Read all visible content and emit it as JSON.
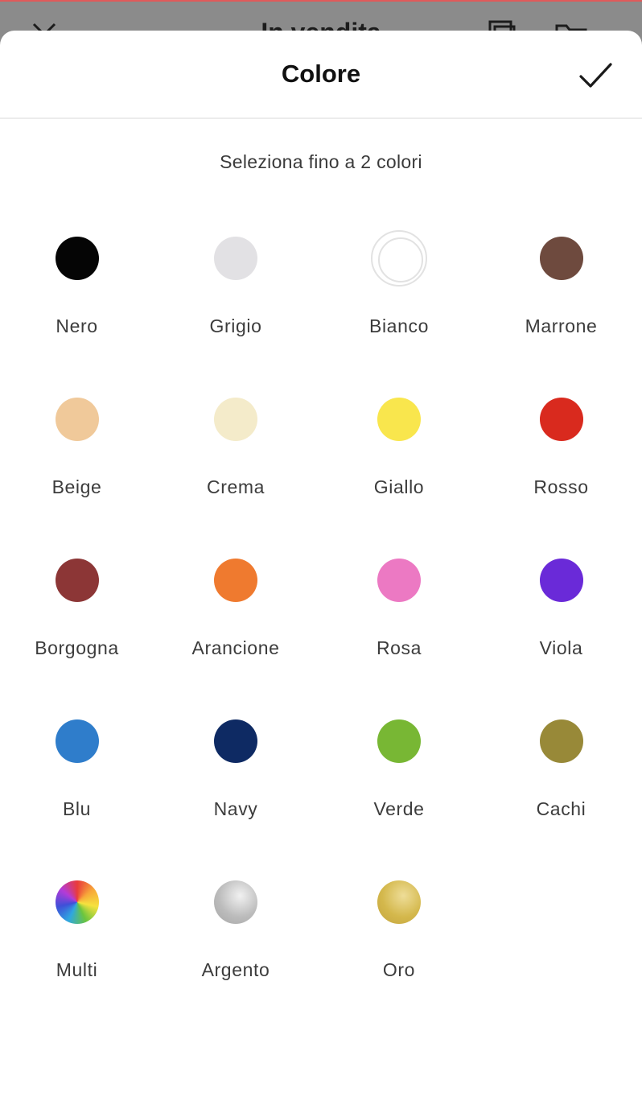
{
  "backdrop": {
    "title": "In vendita"
  },
  "sheet": {
    "title": "Colore",
    "subtitle": "Seleziona fino a 2 colori",
    "confirm_icon": "checkmark-icon"
  },
  "colors": [
    {
      "label": "Nero",
      "fill": "#050505"
    },
    {
      "label": "Grigio",
      "fill": "#e2e1e4"
    },
    {
      "label": "Bianco",
      "fill": "#ffffff"
    },
    {
      "label": "Marrone",
      "fill": "#6e4a3e"
    },
    {
      "label": "Beige",
      "fill": "#f0c99a"
    },
    {
      "label": "Crema",
      "fill": "#f4ebca"
    },
    {
      "label": "Giallo",
      "fill": "#f9e64d"
    },
    {
      "label": "Rosso",
      "fill": "#d92a1e"
    },
    {
      "label": "Borgogna",
      "fill": "#8c3636"
    },
    {
      "label": "Arancione",
      "fill": "#ef7a2f"
    },
    {
      "label": "Rosa",
      "fill": "#ec79c3"
    },
    {
      "label": "Viola",
      "fill": "#6a2ad8"
    },
    {
      "label": "Blu",
      "fill": "#2f7dcb"
    },
    {
      "label": "Navy",
      "fill": "#0e2a63"
    },
    {
      "label": "Verde",
      "fill": "#78b734"
    },
    {
      "label": "Cachi",
      "fill": "#988938"
    },
    {
      "label": "Multi",
      "fill": "conic-gradient(#e93b3b, #f7a73a, #f6e23e, #6bc53e, #2fa7e0, #3f4fd8, #b33bd8, #e93b3b)"
    },
    {
      "label": "Argento",
      "fill": "radial-gradient(circle at 60% 35%, #f1f1f1, #bcbcbc 55%, #a6a6a6)"
    },
    {
      "label": "Oro",
      "fill": "radial-gradient(circle at 60% 35%, #eedd98, #d4b84c 55%, #c4a43f)"
    }
  ]
}
